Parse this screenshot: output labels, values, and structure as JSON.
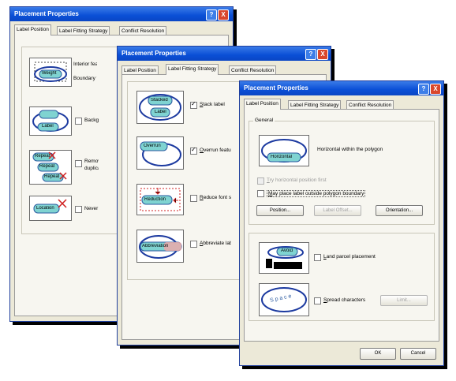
{
  "window_title": "Placement Properties",
  "title_buttons": {
    "help": "?",
    "close": "X"
  },
  "tabs": [
    "Label Position",
    "Label Fitting Strategy",
    "Conflict Resolution"
  ],
  "win1": {
    "rows": [
      {
        "image_text": "Weight",
        "options": [
          "Interior features",
          "Boundary features"
        ]
      },
      {
        "image_text": "Label",
        "options": [
          "Background labels"
        ]
      },
      {
        "image_text": "Repeat",
        "options": [
          "Remove duplicate labels"
        ]
      },
      {
        "image_text": "Location",
        "options": [
          "Never remove"
        ]
      }
    ]
  },
  "win2": {
    "rows": [
      {
        "image_text_1": "Stacked",
        "image_text_2": "Label",
        "option": "Stack label",
        "checked": true
      },
      {
        "image_text_1": "Overrun",
        "option": "Overrun feature",
        "checked": true
      },
      {
        "image_text_1": "Reduction",
        "option": "Reduce font size",
        "checked": false
      },
      {
        "image_text_1": "Abbreviation",
        "option": "Abbreviate label",
        "checked": false
      }
    ]
  },
  "win3": {
    "general_label": "General",
    "horizontal_image_text": "Horizontal",
    "horizontal_desc": "Horizontal within the polygon",
    "try_horizontal": "Try horizontal position first",
    "may_place": "May place label outside polygon boundary",
    "btn_position": "Position...",
    "btn_label_offset": "Label Offset...",
    "btn_orientation": "Orientation...",
    "avoid_image_text": "Avoid",
    "land_parcel": "Land parcel placement",
    "space_image_text": "S p a c e",
    "spread_characters": "Spread characters",
    "btn_limit": "Limit...",
    "ok": "OK",
    "cancel": "Cancel"
  }
}
